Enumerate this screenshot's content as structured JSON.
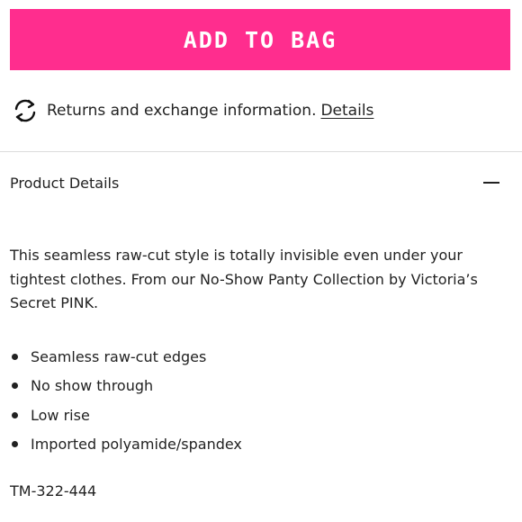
{
  "add_button": {
    "label": "ADD TO BAG",
    "color": "#ff2d8e"
  },
  "returns": {
    "icon": "exchange-arrows-icon",
    "text": "Returns and exchange information.",
    "link_label": "Details"
  },
  "product_details": {
    "title": "Product Details",
    "toggle_icon": "minus-icon",
    "expanded": true,
    "description": "This seamless raw-cut style is totally invisible even under your tightest clothes. From our No-Show Panty Collection by Victoria’s Secret PINK.",
    "bullets": [
      "Seamless raw-cut edges",
      "No show through",
      "Low rise",
      "Imported polyamide/spandex"
    ],
    "sku": "TM-322-444"
  }
}
